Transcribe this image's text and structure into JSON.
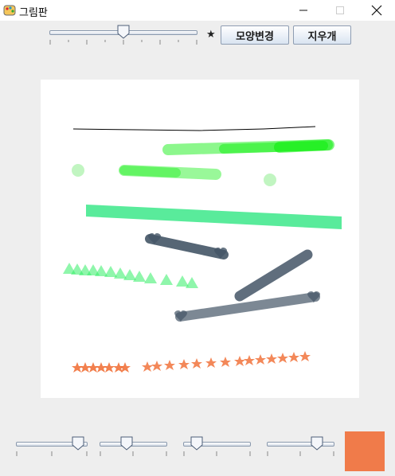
{
  "window": {
    "title": "그림판",
    "minimize_icon": "minimize-icon",
    "maximize_icon": "maximize-icon",
    "close_icon": "close-icon"
  },
  "toolbar": {
    "size_slider_value": 0.5,
    "shape_indicator": "★",
    "change_shape_label": "모양변경",
    "eraser_label": "지우개"
  },
  "bottom_sliders": [
    {
      "name": "red-slider",
      "value": 0.95
    },
    {
      "name": "green-slider",
      "value": 0.37
    },
    {
      "name": "blue-slider",
      "value": 0.13
    },
    {
      "name": "alpha-slider",
      "value": 0.8
    }
  ],
  "colors": {
    "current_color": "#f07b4a",
    "black": "#000000",
    "bright_green": "#00ee00",
    "mint_green": "#00e066",
    "slate": "#445566",
    "orange": "#f06a2f"
  }
}
